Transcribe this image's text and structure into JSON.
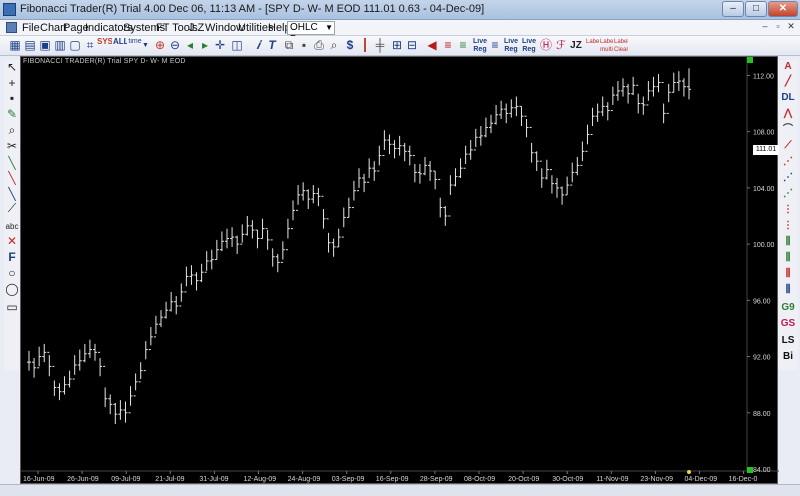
{
  "window": {
    "title": "Fibonacci Trader(R) Trial 4.00 Dec 06,  11:13 AM - [SPY D- W- M EOD  111.01    0.63 - 04-Dec-09]",
    "min_glyph": "–",
    "max_glyph": "□",
    "close_glyph": "✕"
  },
  "menu": {
    "items": [
      "File",
      "Chart",
      "Page",
      "Indicators",
      "Systems",
      "FT Tools",
      "J.Z",
      "Window",
      "Utilities",
      "Help"
    ],
    "chart_type_value": "OHLC Bar",
    "mdi_min": "–",
    "mdi_restore": "▫",
    "mdi_close": "✕"
  },
  "toolbar": {
    "sys_label": "SYS",
    "all_label": "ALL",
    "time_label": "time",
    "live_reg_1": "Live Reg",
    "live_reg_2": "Live Reg",
    "live_reg_3": "Live Reg",
    "jz_label": "JZ",
    "label_1": "Label",
    "label_2": "Label multi",
    "label_3": "Label Clear"
  },
  "left_tools": {
    "abc_label": "abc",
    "f_label": "F"
  },
  "right_tools": {
    "a1": "A",
    "dl": "DL",
    "g9": "G9",
    "gs": "GS",
    "ls": "LS",
    "bi": "Bi"
  },
  "chart_header": "FIBONACCI TRADER(R) Trial     SPY D- W- M EOD",
  "last_price_label": "111.01",
  "colors": {
    "background": "#000000",
    "bars": "#e6e6e6",
    "axis_text": "#d8d8d8",
    "marker": "#22c322"
  },
  "chart_data": {
    "type": "ohlc",
    "symbol": "SPY",
    "x_tick_labels": [
      "16-Jun-09",
      "26-Jun-09",
      "09-Jul-09",
      "21-Jul-09",
      "31-Jul-09",
      "12-Aug-09",
      "24-Aug-09",
      "03-Sep-09",
      "16-Sep-09",
      "28-Sep-09",
      "08-Oct-09",
      "20-Oct-09",
      "30-Oct-09",
      "11-Nov-09",
      "23-Nov-09",
      "04-Dec-09",
      "16-Dec-0"
    ],
    "y_tick_labels": [
      "84.00",
      "88.00",
      "92.00",
      "96.00",
      "100.00",
      "104.00",
      "108.00",
      "112.00"
    ],
    "ylim": [
      84,
      112.6
    ],
    "last_price": 111.01,
    "closes": [
      91.6,
      91.2,
      92.0,
      92.3,
      91.3,
      89.8,
      89.5,
      90.0,
      90.4,
      91.4,
      91.7,
      92.2,
      92.5,
      92.3,
      91.3,
      89.0,
      88.6,
      87.9,
      88.2,
      88.0,
      89.2,
      90.2,
      91.0,
      92.5,
      93.4,
      94.3,
      94.8,
      95.3,
      95.9,
      95.6,
      96.6,
      97.7,
      97.8,
      97.4,
      98.0,
      98.8,
      98.9,
      99.6,
      100.2,
      100.4,
      100.5,
      100.0,
      100.7,
      101.3,
      101.0,
      100.4,
      101.1,
      100.3,
      99.1,
      98.7,
      99.6,
      101.1,
      102.4,
      103.5,
      103.8,
      103.2,
      103.6,
      103.4,
      101.8,
      100.1,
      99.8,
      100.5,
      101.9,
      102.6,
      103.8,
      104.7,
      104.4,
      105.4,
      105.2,
      106.3,
      107.4,
      107.1,
      106.8,
      107.0,
      106.6,
      106.3,
      105.1,
      105.0,
      105.6,
      105.2,
      104.6,
      102.6,
      102.0,
      104.2,
      104.8,
      105.4,
      106.4,
      106.7,
      107.6,
      107.7,
      108.3,
      108.6,
      109.2,
      109.6,
      109.3,
      109.7,
      109.8,
      109.1,
      108.3,
      106.5,
      105.9,
      104.7,
      105.3,
      104.3,
      104.0,
      103.5,
      104.2,
      105.1,
      105.6,
      106.6,
      107.8,
      109.1,
      109.4,
      109.8,
      109.5,
      110.6,
      110.9,
      111.2,
      110.7,
      111.3,
      110.0,
      109.9,
      110.9,
      111.2,
      111.5,
      109.3,
      110.8,
      111.5,
      111.6,
      111.2,
      111.01
    ],
    "highs": [
      92.4,
      91.9,
      92.7,
      92.9,
      92.1,
      90.3,
      90.1,
      90.6,
      91.0,
      92.1,
      92.5,
      92.9,
      93.2,
      92.9,
      91.9,
      89.8,
      89.3,
      88.7,
      88.9,
      88.8,
      89.9,
      90.8,
      91.6,
      93.1,
      94.1,
      94.9,
      95.3,
      95.9,
      96.6,
      96.3,
      97.2,
      98.4,
      98.5,
      98.0,
      98.6,
      99.5,
      99.6,
      100.3,
      100.9,
      101.1,
      101.2,
      100.6,
      101.4,
      102.0,
      101.7,
      101.0,
      101.8,
      101.0,
      99.7,
      99.3,
      100.2,
      101.8,
      103.1,
      104.2,
      104.4,
      103.9,
      104.2,
      104.0,
      102.5,
      100.8,
      100.4,
      101.1,
      102.6,
      103.3,
      104.5,
      105.4,
      105.0,
      106.1,
      105.9,
      107.0,
      108.1,
      107.8,
      107.4,
      107.7,
      107.2,
      107.0,
      105.7,
      105.7,
      106.2,
      105.9,
      105.2,
      103.3,
      102.7,
      104.9,
      105.4,
      106.1,
      107.0,
      107.4,
      108.2,
      108.4,
      109.0,
      109.2,
      109.9,
      110.2,
      110.0,
      110.3,
      110.5,
      109.8,
      108.9,
      107.2,
      106.6,
      105.4,
      106.0,
      104.9,
      104.7,
      104.1,
      104.8,
      105.8,
      106.2,
      107.3,
      108.5,
      109.7,
      110.0,
      110.5,
      110.1,
      111.2,
      111.6,
      111.8,
      111.4,
      111.9,
      110.7,
      110.5,
      111.6,
      111.9,
      112.1,
      110.0,
      111.4,
      112.2,
      112.3,
      111.8,
      112.5
    ],
    "lows": [
      91.0,
      90.5,
      91.3,
      91.6,
      90.6,
      89.2,
      88.9,
      89.3,
      89.8,
      90.7,
      91.0,
      91.6,
      91.9,
      91.7,
      90.6,
      88.4,
      87.9,
      87.2,
      87.5,
      87.3,
      88.5,
      89.6,
      90.4,
      91.8,
      92.8,
      93.6,
      94.1,
      94.7,
      95.2,
      95.0,
      95.9,
      97.0,
      97.1,
      96.7,
      97.3,
      98.1,
      98.2,
      98.9,
      99.5,
      99.7,
      99.8,
      99.3,
      100.1,
      100.6,
      100.4,
      99.7,
      100.4,
      99.6,
      98.4,
      98.0,
      98.9,
      100.4,
      101.7,
      102.8,
      103.1,
      102.5,
      102.9,
      102.7,
      101.1,
      99.4,
      99.1,
      99.8,
      101.2,
      101.9,
      103.1,
      104.0,
      103.7,
      104.7,
      104.5,
      105.6,
      106.7,
      106.4,
      106.1,
      106.3,
      105.9,
      105.6,
      104.4,
      104.3,
      104.9,
      104.5,
      103.9,
      101.9,
      101.3,
      103.5,
      104.1,
      104.7,
      105.7,
      106.0,
      106.9,
      107.0,
      107.6,
      107.9,
      108.5,
      108.9,
      108.6,
      109.0,
      109.1,
      108.4,
      107.6,
      105.8,
      105.2,
      104.0,
      104.6,
      103.6,
      103.3,
      102.8,
      103.5,
      104.4,
      104.9,
      105.9,
      107.1,
      108.4,
      108.7,
      109.1,
      108.8,
      109.9,
      110.2,
      110.5,
      110.0,
      110.6,
      109.3,
      109.2,
      110.2,
      110.5,
      110.8,
      108.6,
      110.1,
      110.8,
      110.9,
      110.5,
      110.3
    ]
  }
}
